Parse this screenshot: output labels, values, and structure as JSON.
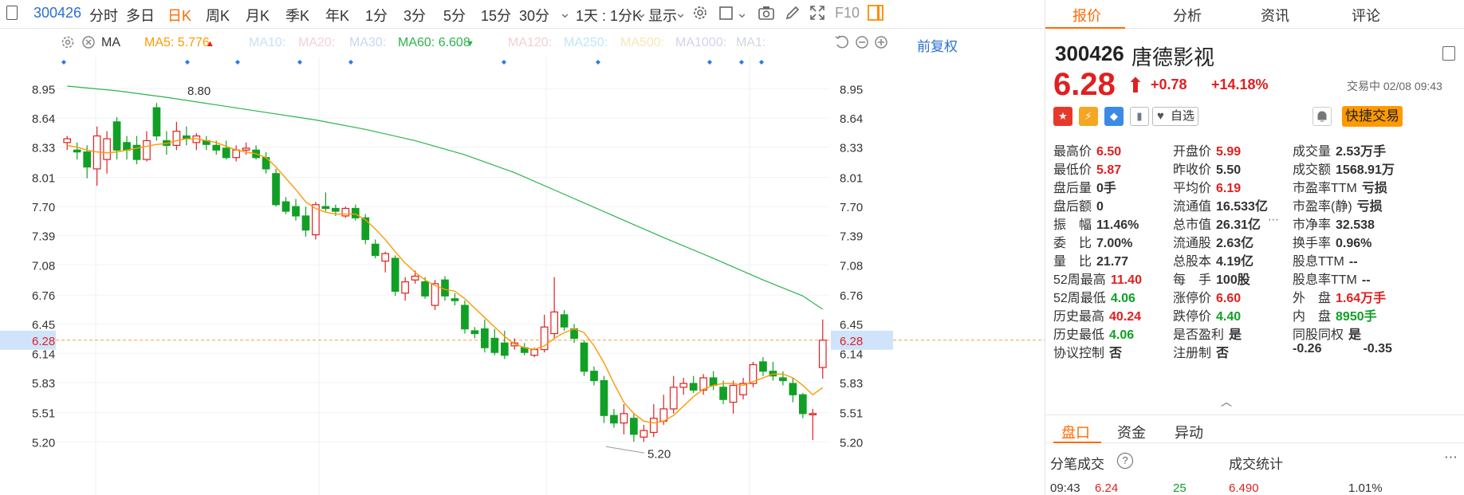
{
  "toolbar": {
    "code": "300426",
    "periods": [
      "分时",
      "多日",
      "日K",
      "周K",
      "月K",
      "季K",
      "年K",
      "1分",
      "3分",
      "5分",
      "15分",
      "30分"
    ],
    "active_period": "日K",
    "multi_period": "1天 : 1分K",
    "display_label": "显示",
    "f10_label": "F10"
  },
  "ma_bar": {
    "type_label": "MA",
    "ma5": "MA5: 5.776",
    "ma10": "MA10:",
    "ma20": "MA20:",
    "ma30": "MA30:",
    "ma60": "MA60: 6.608",
    "ma120": "MA120:",
    "ma250": "MA250:",
    "ma500": "MA500:",
    "ma1000": "MA1000:",
    "ma1x": "MA1:",
    "fuquan": "前复权",
    "colors": {
      "ma5": "#ff9900",
      "ma60": "#2ab44a",
      "dim": "#c9d6ee"
    }
  },
  "chart_data": {
    "type": "candlestick",
    "y_ticks": [
      "8.95",
      "8.64",
      "8.33",
      "8.01",
      "7.70",
      "7.39",
      "7.08",
      "6.76",
      "6.45",
      "6.14",
      "5.83",
      "5.51",
      "5.20"
    ],
    "ylim": [
      5.05,
      9.2
    ],
    "current_price_label": "6.28",
    "current_price": 6.28,
    "high_annotation": "8.80",
    "high_value": 8.8,
    "low_annotation": "5.20",
    "low_value": 5.2,
    "up_color": "#e02020",
    "down_color": "#11a025",
    "candles": [
      {
        "o": 8.38,
        "h": 8.45,
        "l": 8.3,
        "c": 8.42
      },
      {
        "o": 8.3,
        "h": 8.38,
        "l": 8.2,
        "c": 8.28
      },
      {
        "o": 8.28,
        "h": 8.35,
        "l": 8.0,
        "c": 8.12
      },
      {
        "o": 8.1,
        "h": 8.55,
        "l": 7.92,
        "c": 8.45
      },
      {
        "o": 8.2,
        "h": 8.5,
        "l": 8.05,
        "c": 8.42
      },
      {
        "o": 8.6,
        "h": 8.65,
        "l": 8.2,
        "c": 8.3
      },
      {
        "o": 8.38,
        "h": 8.45,
        "l": 8.2,
        "c": 8.3
      },
      {
        "o": 8.35,
        "h": 8.45,
        "l": 8.15,
        "c": 8.2
      },
      {
        "o": 8.2,
        "h": 8.5,
        "l": 8.18,
        "c": 8.4
      },
      {
        "o": 8.75,
        "h": 8.8,
        "l": 8.4,
        "c": 8.45
      },
      {
        "o": 8.4,
        "h": 8.5,
        "l": 8.25,
        "c": 8.35
      },
      {
        "o": 8.35,
        "h": 8.6,
        "l": 8.3,
        "c": 8.5
      },
      {
        "o": 8.45,
        "h": 8.55,
        "l": 8.35,
        "c": 8.42
      },
      {
        "o": 8.38,
        "h": 8.48,
        "l": 8.3,
        "c": 8.45
      },
      {
        "o": 8.4,
        "h": 8.45,
        "l": 8.3,
        "c": 8.36
      },
      {
        "o": 8.35,
        "h": 8.4,
        "l": 8.25,
        "c": 8.3
      },
      {
        "o": 8.32,
        "h": 8.4,
        "l": 8.2,
        "c": 8.22
      },
      {
        "o": 8.22,
        "h": 8.35,
        "l": 8.18,
        "c": 8.3
      },
      {
        "o": 8.3,
        "h": 8.38,
        "l": 8.25,
        "c": 8.32
      },
      {
        "o": 8.3,
        "h": 8.35,
        "l": 8.2,
        "c": 8.22
      },
      {
        "o": 8.22,
        "h": 8.28,
        "l": 8.05,
        "c": 8.1
      },
      {
        "o": 8.05,
        "h": 8.1,
        "l": 7.7,
        "c": 7.72
      },
      {
        "o": 7.75,
        "h": 7.8,
        "l": 7.62,
        "c": 7.65
      },
      {
        "o": 7.7,
        "h": 7.78,
        "l": 7.55,
        "c": 7.6
      },
      {
        "o": 7.6,
        "h": 7.7,
        "l": 7.38,
        "c": 7.45
      },
      {
        "o": 7.4,
        "h": 7.75,
        "l": 7.35,
        "c": 7.72
      },
      {
        "o": 7.7,
        "h": 7.85,
        "l": 7.65,
        "c": 7.68
      },
      {
        "o": 7.68,
        "h": 7.72,
        "l": 7.6,
        "c": 7.65
      },
      {
        "o": 7.6,
        "h": 7.7,
        "l": 7.58,
        "c": 7.68
      },
      {
        "o": 7.68,
        "h": 7.72,
        "l": 7.55,
        "c": 7.58
      },
      {
        "o": 7.58,
        "h": 7.62,
        "l": 7.3,
        "c": 7.35
      },
      {
        "o": 7.3,
        "h": 7.35,
        "l": 7.15,
        "c": 7.18
      },
      {
        "o": 7.12,
        "h": 7.22,
        "l": 7.0,
        "c": 7.2
      },
      {
        "o": 7.15,
        "h": 7.18,
        "l": 6.75,
        "c": 6.8
      },
      {
        "o": 6.78,
        "h": 6.95,
        "l": 6.7,
        "c": 6.9
      },
      {
        "o": 6.92,
        "h": 7.02,
        "l": 6.88,
        "c": 6.96
      },
      {
        "o": 6.9,
        "h": 6.95,
        "l": 6.72,
        "c": 6.75
      },
      {
        "o": 6.65,
        "h": 6.92,
        "l": 6.6,
        "c": 6.88
      },
      {
        "o": 6.92,
        "h": 6.96,
        "l": 6.7,
        "c": 6.75
      },
      {
        "o": 6.72,
        "h": 6.78,
        "l": 6.65,
        "c": 6.7
      },
      {
        "o": 6.65,
        "h": 6.7,
        "l": 6.35,
        "c": 6.4
      },
      {
        "o": 6.38,
        "h": 6.42,
        "l": 6.3,
        "c": 6.35
      },
      {
        "o": 6.4,
        "h": 6.5,
        "l": 6.15,
        "c": 6.2
      },
      {
        "o": 6.3,
        "h": 6.4,
        "l": 6.12,
        "c": 6.15
      },
      {
        "o": 6.25,
        "h": 6.38,
        "l": 6.08,
        "c": 6.12
      },
      {
        "o": 6.22,
        "h": 6.3,
        "l": 6.18,
        "c": 6.25
      },
      {
        "o": 6.2,
        "h": 6.25,
        "l": 6.12,
        "c": 6.15
      },
      {
        "o": 6.12,
        "h": 6.2,
        "l": 6.1,
        "c": 6.18
      },
      {
        "o": 6.18,
        "h": 6.55,
        "l": 6.15,
        "c": 6.42
      },
      {
        "o": 6.35,
        "h": 6.95,
        "l": 6.3,
        "c": 6.58
      },
      {
        "o": 6.55,
        "h": 6.6,
        "l": 6.38,
        "c": 6.42
      },
      {
        "o": 6.4,
        "h": 6.45,
        "l": 6.25,
        "c": 6.3
      },
      {
        "o": 6.25,
        "h": 6.28,
        "l": 5.9,
        "c": 5.95
      },
      {
        "o": 5.95,
        "h": 6.0,
        "l": 5.8,
        "c": 5.85
      },
      {
        "o": 5.85,
        "h": 5.9,
        "l": 5.4,
        "c": 5.48
      },
      {
        "o": 5.48,
        "h": 5.55,
        "l": 5.35,
        "c": 5.4
      },
      {
        "o": 5.4,
        "h": 5.6,
        "l": 5.28,
        "c": 5.5
      },
      {
        "o": 5.45,
        "h": 5.5,
        "l": 5.2,
        "c": 5.28
      },
      {
        "o": 5.25,
        "h": 5.38,
        "l": 5.2,
        "c": 5.32
      },
      {
        "o": 5.3,
        "h": 5.6,
        "l": 5.25,
        "c": 5.45
      },
      {
        "o": 5.42,
        "h": 5.7,
        "l": 5.38,
        "c": 5.55
      },
      {
        "o": 5.55,
        "h": 5.9,
        "l": 5.5,
        "c": 5.78
      },
      {
        "o": 5.78,
        "h": 5.88,
        "l": 5.7,
        "c": 5.82
      },
      {
        "o": 5.82,
        "h": 5.9,
        "l": 5.72,
        "c": 5.75
      },
      {
        "o": 5.75,
        "h": 5.92,
        "l": 5.7,
        "c": 5.88
      },
      {
        "o": 5.88,
        "h": 5.95,
        "l": 5.75,
        "c": 5.8
      },
      {
        "o": 5.78,
        "h": 5.85,
        "l": 5.6,
        "c": 5.65
      },
      {
        "o": 5.62,
        "h": 5.85,
        "l": 5.5,
        "c": 5.8
      },
      {
        "o": 5.7,
        "h": 5.88,
        "l": 5.65,
        "c": 5.82
      },
      {
        "o": 5.82,
        "h": 6.05,
        "l": 5.78,
        "c": 6.02
      },
      {
        "o": 6.05,
        "h": 6.1,
        "l": 5.9,
        "c": 5.95
      },
      {
        "o": 5.95,
        "h": 6.05,
        "l": 5.85,
        "c": 5.9
      },
      {
        "o": 5.88,
        "h": 5.95,
        "l": 5.8,
        "c": 5.85
      },
      {
        "o": 5.82,
        "h": 5.88,
        "l": 5.62,
        "c": 5.7
      },
      {
        "o": 5.7,
        "h": 5.72,
        "l": 5.45,
        "c": 5.5
      },
      {
        "o": 5.5,
        "h": 5.55,
        "l": 5.22,
        "c": 5.5
      },
      {
        "o": 5.99,
        "h": 6.5,
        "l": 5.87,
        "c": 6.28
      }
    ],
    "ma5": [
      8.35,
      8.33,
      8.3,
      8.28,
      8.27,
      8.28,
      8.3,
      8.32,
      8.34,
      8.36,
      8.37,
      8.4,
      8.42,
      8.42,
      8.4,
      8.38,
      8.34,
      8.3,
      8.28,
      8.26,
      8.22,
      8.12,
      8.0,
      7.88,
      7.75,
      7.68,
      7.64,
      7.62,
      7.62,
      7.62,
      7.56,
      7.46,
      7.35,
      7.22,
      7.1,
      7.0,
      6.92,
      6.86,
      6.82,
      6.8,
      6.72,
      6.62,
      6.52,
      6.42,
      6.32,
      6.24,
      6.2,
      6.18,
      6.22,
      6.3,
      6.36,
      6.4,
      6.36,
      6.22,
      6.04,
      5.82,
      5.62,
      5.5,
      5.42,
      5.4,
      5.42,
      5.48,
      5.58,
      5.68,
      5.76,
      5.8,
      5.82,
      5.82,
      5.8,
      5.84,
      5.88,
      5.92,
      5.92,
      5.88,
      5.8,
      5.7,
      5.776
    ],
    "ma60_points": [
      [
        0,
        8.98
      ],
      [
        5,
        8.93
      ],
      [
        10,
        8.86
      ],
      [
        15,
        8.78
      ],
      [
        20,
        8.7
      ],
      [
        25,
        8.62
      ],
      [
        30,
        8.52
      ],
      [
        35,
        8.4
      ],
      [
        40,
        8.25
      ],
      [
        45,
        8.06
      ],
      [
        50,
        7.83
      ],
      [
        55,
        7.6
      ],
      [
        60,
        7.37
      ],
      [
        65,
        7.15
      ],
      [
        70,
        6.92
      ],
      [
        74,
        6.75
      ],
      [
        76,
        6.608
      ]
    ]
  },
  "right_panel": {
    "tabs": [
      "报价",
      "分析",
      "资讯",
      "评论"
    ],
    "active_tab": "报价",
    "stock_code": "300426",
    "stock_name": "唐德影视",
    "price": "6.28",
    "change": "+0.78",
    "change_pct": "+14.18%",
    "trade_status": "交易中 02/08 09:43",
    "watch_label": "自选",
    "quick_trade_label": "快捷交易",
    "badges": [
      {
        "name": "china-flag-icon",
        "glyph": "★",
        "color": "#e8382b"
      },
      {
        "name": "lightning-icon",
        "glyph": "⚡",
        "color": "#f5a623"
      },
      {
        "name": "tag-icon",
        "glyph": "◆",
        "color": "#3b8ae6"
      },
      {
        "name": "bookmark-icon",
        "glyph": "▮",
        "color": "#6b7a8f"
      }
    ],
    "quotes": {
      "col1": [
        {
          "k": "最高价",
          "v": "6.50",
          "c": "red"
        },
        {
          "k": "最低价",
          "v": "5.87",
          "c": "red"
        },
        {
          "k": "盘后量",
          "v": "0手",
          "c": ""
        },
        {
          "k": "盘后额",
          "v": "0",
          "c": ""
        },
        {
          "k": "振　幅",
          "v": "11.46%",
          "c": ""
        },
        {
          "k": "委　比",
          "v": "7.00%",
          "c": ""
        },
        {
          "k": "量　比",
          "v": "21.77",
          "c": ""
        },
        {
          "k": "52周最高",
          "v": "11.40",
          "c": "red"
        },
        {
          "k": "52周最低",
          "v": "4.06",
          "c": "green"
        },
        {
          "k": "历史最高",
          "v": "40.24",
          "c": "red"
        },
        {
          "k": "历史最低",
          "v": "4.06",
          "c": "green"
        },
        {
          "k": "协议控制",
          "v": "否",
          "c": ""
        }
      ],
      "col2": [
        {
          "k": "开盘价",
          "v": "5.99",
          "c": "red"
        },
        {
          "k": "昨收价",
          "v": "5.50",
          "c": ""
        },
        {
          "k": "平均价",
          "v": "6.19",
          "c": "red"
        },
        {
          "k": "流通值",
          "v": "16.533亿",
          "c": ""
        },
        {
          "k": "总市值",
          "v": "26.31亿",
          "c": ""
        },
        {
          "k": "流通股",
          "v": "2.63亿",
          "c": ""
        },
        {
          "k": "总股本",
          "v": "4.19亿",
          "c": ""
        },
        {
          "k": "每　手",
          "v": "100股",
          "c": ""
        },
        {
          "k": "涨停价",
          "v": "6.60",
          "c": "red"
        },
        {
          "k": "跌停价",
          "v": "4.40",
          "c": "green"
        },
        {
          "k": "是否盈利",
          "v": "是",
          "c": ""
        },
        {
          "k": "注册制",
          "v": "否",
          "c": ""
        }
      ],
      "col3": [
        {
          "k": "成交量",
          "v": "2.53万手",
          "c": ""
        },
        {
          "k": "成交额",
          "v": "1568.91万",
          "c": ""
        },
        {
          "k": "市盈率TTM",
          "v": "亏损",
          "c": ""
        },
        {
          "k": "市盈率(静)",
          "v": "亏损",
          "c": ""
        },
        {
          "k": "市净率",
          "v": "32.538",
          "c": ""
        },
        {
          "k": "换手率",
          "v": "0.96%",
          "c": ""
        },
        {
          "k": "股息TTM",
          "v": "--",
          "c": ""
        },
        {
          "k": "股息率TTM",
          "v": "--",
          "c": ""
        },
        {
          "k": "外　盘",
          "v": "1.64万手",
          "c": "red"
        },
        {
          "k": "内　盘",
          "v": "8950手",
          "c": "green"
        },
        {
          "k": "同股同权",
          "v": "是",
          "c": ""
        },
        {
          "k": "-0.26",
          "v": "-0.35",
          "c": ""
        }
      ]
    },
    "subtabs": [
      "盘口",
      "资金",
      "异动"
    ],
    "active_subtab": "盘口",
    "bottom": {
      "trades_title": "分笔成交",
      "stats_title": "成交统计",
      "trade_time": "09:43",
      "trade_price": "6.24",
      "trade_vol": "25",
      "stats_price": "6.490",
      "stats_pct": "1.01%"
    }
  }
}
